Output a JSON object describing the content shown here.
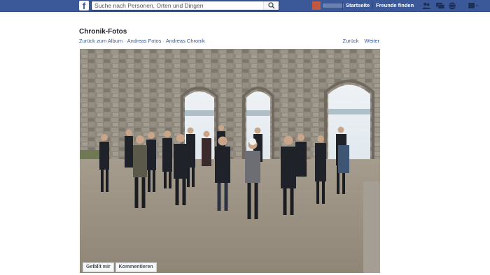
{
  "topbar": {
    "logo": "f",
    "search_placeholder": "Suche nach Personen, Orten und Dingen",
    "home_label": "Startseite",
    "friends_label": "Freunde finden",
    "icons": [
      "friend-requests-icon",
      "messages-icon",
      "notifications-icon",
      "settings-icon"
    ],
    "brand_color": "#3b5998"
  },
  "header": {
    "title": "Chronik-Fotos",
    "breadcrumbs": [
      "Zurück zum Album",
      "Andreas Fotos",
      "Andreas Chronik"
    ],
    "back_label": "Zurück",
    "next_label": "Weiter"
  },
  "photo_actions": {
    "like_label": "Gefällt mir",
    "comment_label": "Kommentieren"
  }
}
